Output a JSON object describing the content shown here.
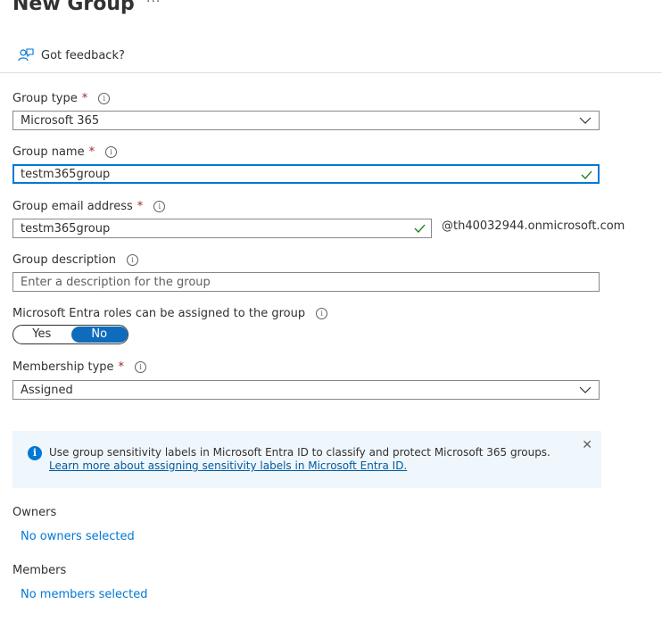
{
  "header": {
    "title": "New Group",
    "more": "···"
  },
  "feedback": {
    "label": "Got feedback?"
  },
  "group_type": {
    "label": "Group type",
    "required": "*",
    "info": "i",
    "value": "Microsoft 365"
  },
  "group_name": {
    "label": "Group name",
    "required": "*",
    "info": "i",
    "value": "testm365group"
  },
  "group_email": {
    "label": "Group email address",
    "required": "*",
    "info": "i",
    "value": "testm365group",
    "domain": "@th40032944.onmicrosoft.com"
  },
  "group_description": {
    "label": "Group description",
    "info": "i",
    "placeholder": "Enter a description for the group"
  },
  "entra_roles": {
    "label": "Microsoft Entra roles can be assigned to the group",
    "info": "i",
    "options": [
      "Yes",
      "No"
    ],
    "selected": "No"
  },
  "membership_type": {
    "label": "Membership type",
    "required": "*",
    "info": "i",
    "value": "Assigned"
  },
  "banner": {
    "icon": "i",
    "text": "Use group sensitivity labels in Microsoft Entra ID to classify and protect Microsoft 365 groups.",
    "link": "Learn more about assigning sensitivity labels in Microsoft Entra ID.",
    "close": "✕"
  },
  "owners": {
    "label": "Owners",
    "link": "No owners selected"
  },
  "members": {
    "label": "Members",
    "link": "No members selected"
  },
  "colors": {
    "accent": "#0078d4",
    "toggle_selected": "#0f6cbd",
    "required": "#a4262c",
    "check": "#107c10",
    "banner_bg": "#eff6fc"
  }
}
